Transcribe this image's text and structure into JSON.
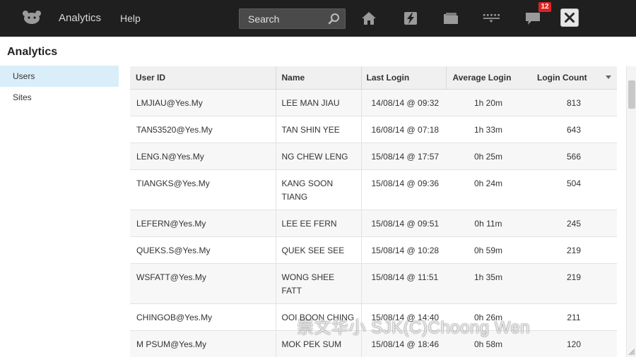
{
  "topbar": {
    "brand_label": "Analytics",
    "help_label": "Help",
    "search_placeholder": "Search",
    "notification_count": "12",
    "icons": [
      "logo-icon",
      "search-icon",
      "home-icon",
      "bolt-icon",
      "folder-icon",
      "grid-icon",
      "chat-icon",
      "close-icon"
    ]
  },
  "page": {
    "title": "Analytics"
  },
  "sidebar": {
    "items": [
      {
        "label": "Users",
        "active": true
      },
      {
        "label": "Sites",
        "active": false
      }
    ]
  },
  "table": {
    "columns": [
      "User ID",
      "Name",
      "Last Login",
      "Average Login",
      "Login Count"
    ],
    "rows": [
      {
        "user_id": "LMJIAU@Yes.My",
        "name": "LEE MAN JIAU",
        "last_login": "14/08/14 @ 09:32",
        "avg_login": "1h 20m",
        "count": "813"
      },
      {
        "user_id": "TAN53520@Yes.My",
        "name": "TAN SHIN YEE",
        "last_login": "16/08/14 @ 07:18",
        "avg_login": "1h 33m",
        "count": "643"
      },
      {
        "user_id": "LENG.N@Yes.My",
        "name": "NG CHEW LENG",
        "last_login": "15/08/14 @ 17:57",
        "avg_login": "0h 25m",
        "count": "566"
      },
      {
        "user_id": "TIANGKS@Yes.My",
        "name": "KANG SOON TIANG",
        "last_login": "15/08/14 @ 09:36",
        "avg_login": "0h 24m",
        "count": "504"
      },
      {
        "user_id": "LEFERN@Yes.My",
        "name": "LEE EE FERN",
        "last_login": "15/08/14 @ 09:51",
        "avg_login": "0h 11m",
        "count": "245"
      },
      {
        "user_id": "QUEKS.S@Yes.My",
        "name": "QUEK SEE SEE",
        "last_login": "15/08/14 @ 10:28",
        "avg_login": "0h 59m",
        "count": "219"
      },
      {
        "user_id": "WSFATT@Yes.My",
        "name": "WONG SHEE FATT",
        "last_login": "15/08/14 @ 11:51",
        "avg_login": "1h 35m",
        "count": "219"
      },
      {
        "user_id": "CHINGOB@Yes.My",
        "name": "OOI BOON CHING",
        "last_login": "15/08/14 @ 14:40",
        "avg_login": "0h 26m",
        "count": "211"
      },
      {
        "user_id": "M PSUM@Yes.My",
        "name": "MOK PEK SUM",
        "last_login": "15/08/14 @ 18:46",
        "avg_login": "0h 58m",
        "count": "120"
      }
    ]
  },
  "watermark": "崇文华小 SJK(C)Choong Wen",
  "colors": {
    "topbar_bg": "#1f1f1f",
    "sidebar_active_bg": "#d9eef8",
    "badge_bg": "#e02222",
    "header_bg": "#f0f0f0",
    "row_alt_bg": "#f7f7f7"
  }
}
